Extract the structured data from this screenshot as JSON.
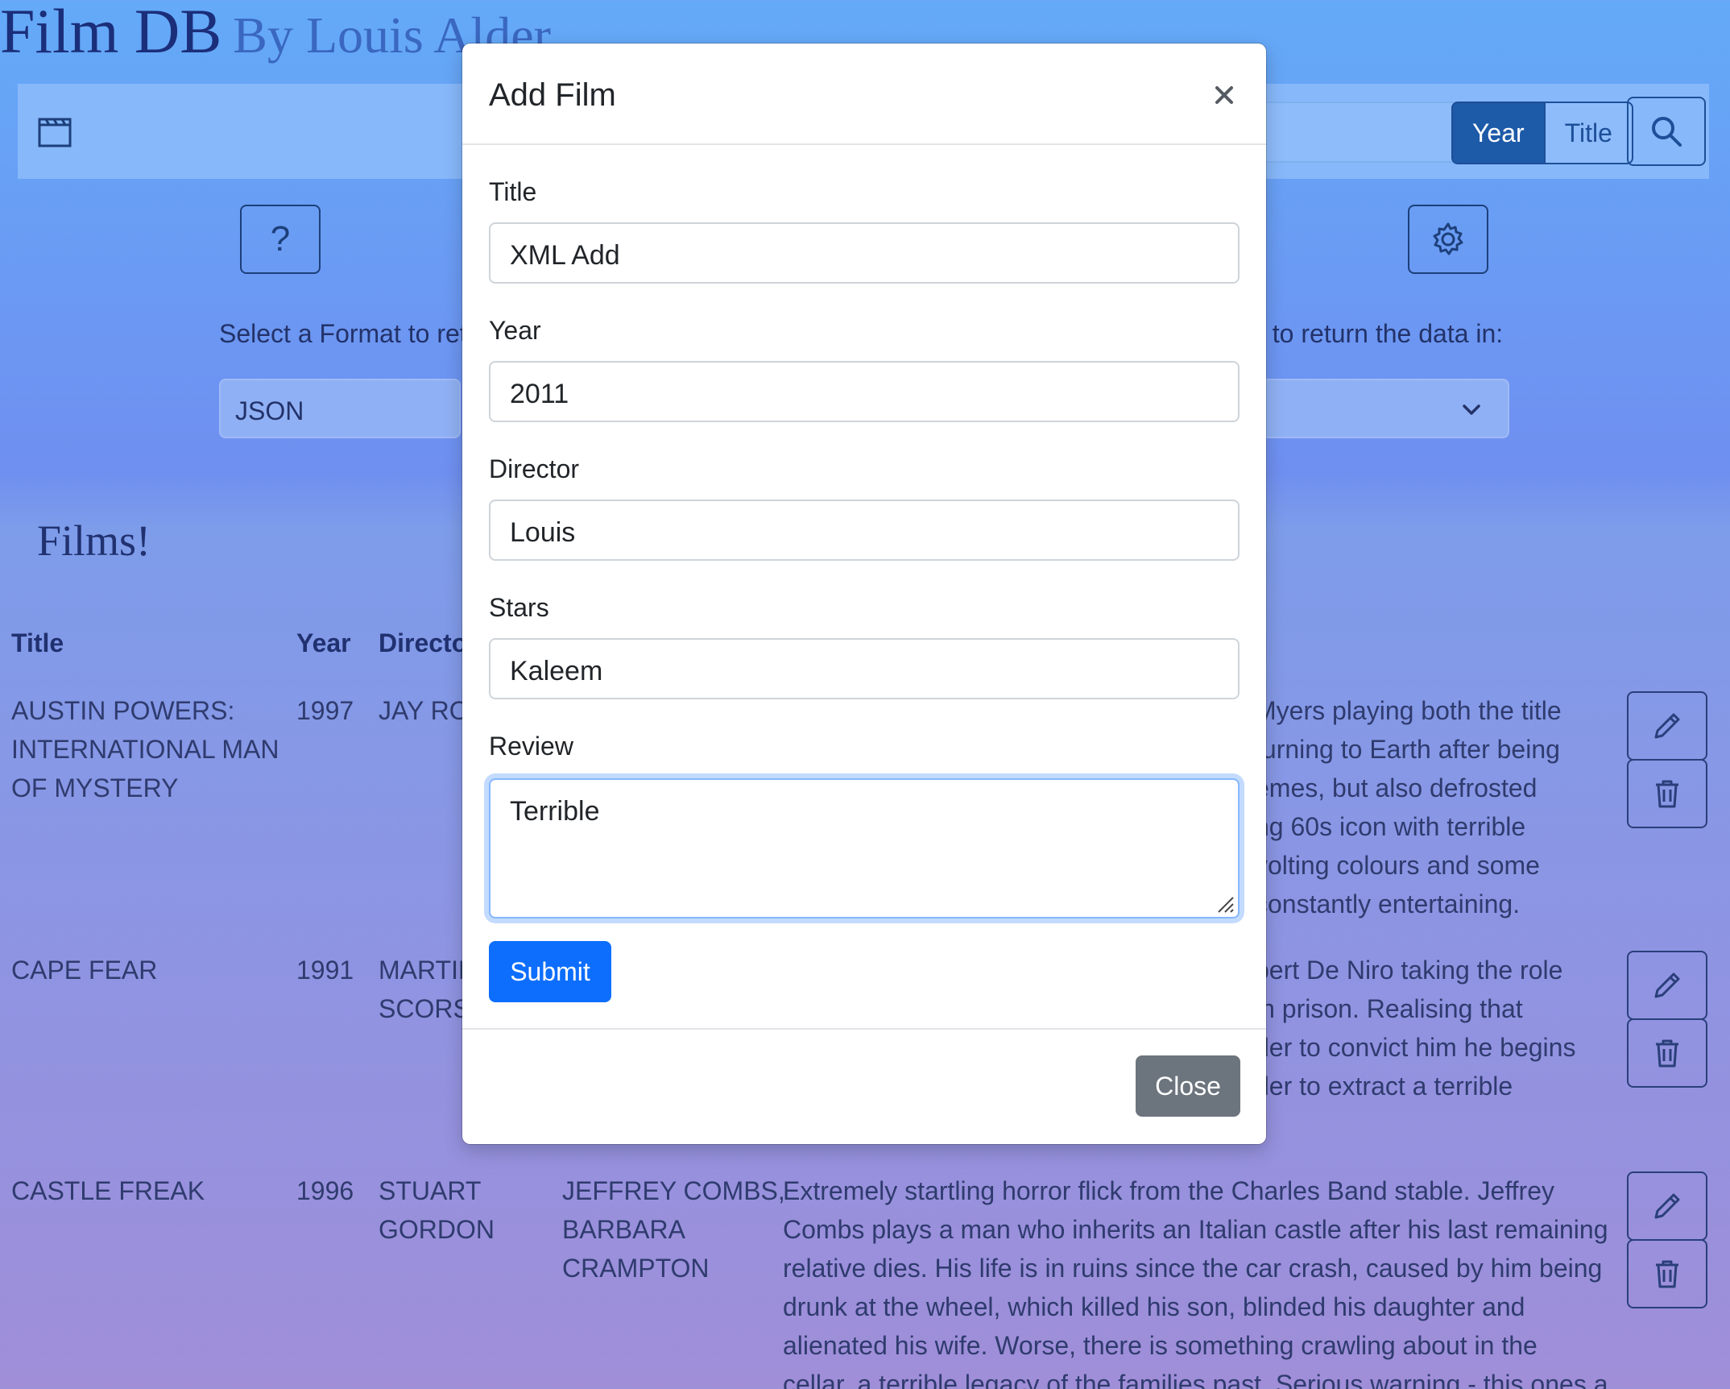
{
  "header": {
    "title": "Film DB",
    "subtitle": "By Louis Alder"
  },
  "navbar": {
    "search_placeholder": "",
    "search_options": [
      "Year",
      "Title"
    ],
    "active_search_option": "Year"
  },
  "controls": {
    "help_label": "?",
    "format_label_left": "Select a Format to ret",
    "format_label_right": "t to return the data in:",
    "format_value": "JSON"
  },
  "films_section": {
    "title": "Films!",
    "columns": [
      "Title",
      "Year",
      "Directo"
    ],
    "rows": [
      {
        "title_lines": [
          "AUSTIN POWERS:",
          "INTERNATIONAL MAN",
          "OF MYSTERY"
        ],
        "year": "1997",
        "director_lines": [
          "JAY ROA"
        ],
        "stars_lines": [],
        "review_lines": [
          "Myers playing both the title",
          "turning to Earth after being",
          "emes, but also defrosted",
          "ng 60s icon with terrible",
          "volting colours and some",
          "constantly entertaining."
        ]
      },
      {
        "title_lines": [
          "CAPE FEAR"
        ],
        "year": "1991",
        "director_lines": [
          "MARTIN",
          "SCORSE"
        ],
        "stars_lines": [],
        "review_lines": [
          "bert De Niro taking the role",
          "in prison. Realising that",
          "der to convict him he begins",
          "der to extract a terrible"
        ]
      },
      {
        "title_lines": [
          "CASTLE FREAK"
        ],
        "year": "1996",
        "director_lines": [
          "STUART",
          "GORDON"
        ],
        "stars_lines": [
          "JEFFREY COMBS,",
          "BARBARA",
          "CRAMPTON"
        ],
        "review_lines": [
          "Extremely startling horror flick from the Charles Band stable. Jeffrey",
          "Combs plays a man who inherits an Italian castle after his last remaining",
          "relative dies. His life is in ruins since the car crash, caused by him being",
          "drunk at the wheel, which killed his son, blinded his daughter and",
          "alienated his wife. Worse, there is something crawling about in the",
          "cellar, a terrible legacy of the families past. Serious warning - this ones a"
        ]
      }
    ]
  },
  "modal": {
    "title": "Add Film",
    "fields": {
      "title_label": "Title",
      "title_value": "XML Add",
      "year_label": "Year",
      "year_value": "2011",
      "director_label": "Director",
      "director_value": "Louis",
      "stars_label": "Stars",
      "stars_value": "Kaleem",
      "review_label": "Review",
      "review_value": "Terrible"
    },
    "submit_label": "Submit",
    "close_label": "Close"
  },
  "icons": {
    "film": "clapperboard-icon",
    "search": "search-icon",
    "settings": "gear-icon",
    "edit": "pencil-icon",
    "delete": "trash-icon",
    "close": "close-icon",
    "dropdown": "chevron-down-icon"
  },
  "colors": {
    "primary": "#0d6efd",
    "secondary": "#6c757d",
    "nav_active": "#1d5aa8"
  }
}
